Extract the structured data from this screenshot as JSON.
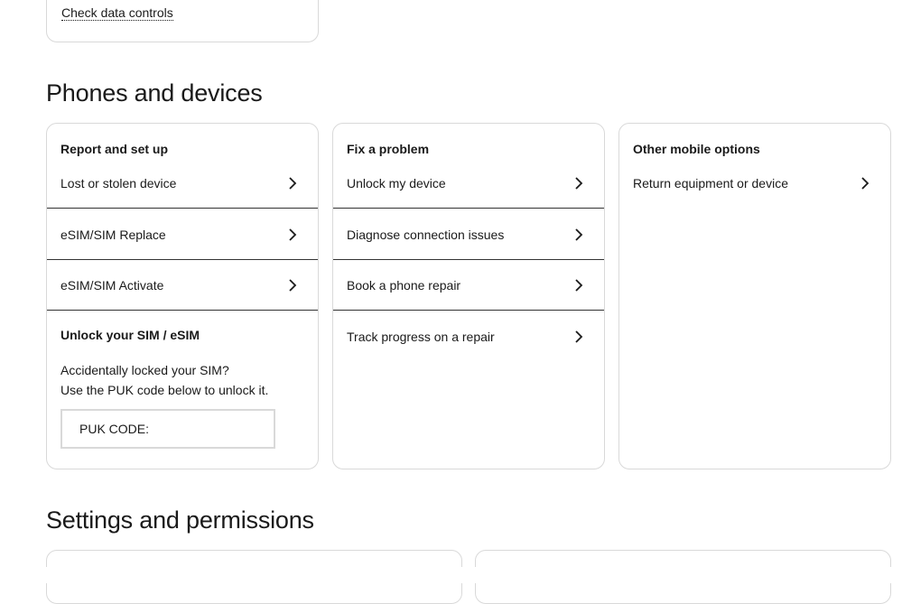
{
  "top_card": {
    "link": "Check data controls"
  },
  "phones_section": {
    "title": "Phones and devices",
    "cards": [
      {
        "heading": "Report and set up",
        "items": [
          {
            "label": "Lost or stolen device",
            "icon": "chevron-right-icon"
          },
          {
            "label": "eSIM/SIM Replace",
            "icon": "chevron-right-icon"
          },
          {
            "label": "eSIM/SIM Activate",
            "icon": "chevron-right-icon"
          }
        ],
        "unlock": {
          "heading": "Unlock your SIM / eSIM",
          "line1": "Accidentally locked your SIM?",
          "line2": "Use the PUK code below to unlock it.",
          "puk_label": "PUK CODE:"
        }
      },
      {
        "heading": "Fix a problem",
        "items": [
          {
            "label": "Unlock my device",
            "icon": "chevron-right-icon"
          },
          {
            "label": "Diagnose connection issues",
            "icon": "chevron-right-icon"
          },
          {
            "label": "Book a phone repair",
            "icon": "chevron-right-icon"
          },
          {
            "label": "Track progress on a repair",
            "icon": "chevron-right-icon"
          }
        ]
      },
      {
        "heading": "Other mobile options",
        "items": [
          {
            "label": "Return equipment or device",
            "icon": "chevron-right-icon"
          }
        ]
      }
    ]
  },
  "settings_section": {
    "title": "Settings and permissions"
  }
}
